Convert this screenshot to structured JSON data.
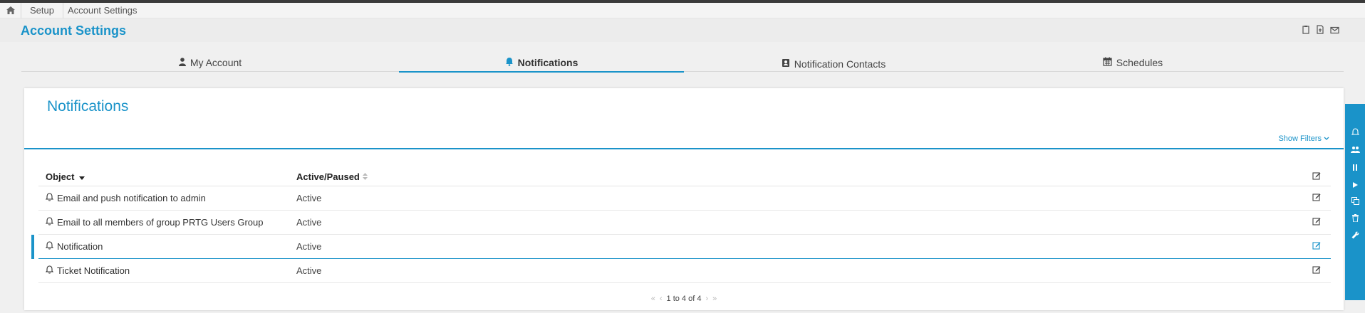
{
  "breadcrumb": {
    "items": [
      "Setup",
      "Account Settings"
    ]
  },
  "header": {
    "title": "Account Settings"
  },
  "tabs": [
    {
      "label": "My Account",
      "icon": "user-icon"
    },
    {
      "label": "Notifications",
      "icon": "bell-icon"
    },
    {
      "label": "Notification Contacts",
      "icon": "contact-icon"
    },
    {
      "label": "Schedules",
      "icon": "calendar-icon"
    }
  ],
  "panel": {
    "title": "Notifications",
    "show_filters": "Show Filters",
    "columns": {
      "object": "Object",
      "status": "Active/Paused"
    },
    "rows": [
      {
        "name": "Email and push notification to admin",
        "status": "Active"
      },
      {
        "name": "Email to all members of group PRTG Users Group",
        "status": "Active"
      },
      {
        "name": "Notification",
        "status": "Active"
      },
      {
        "name": "Ticket Notification",
        "status": "Active"
      }
    ],
    "pager": {
      "text": "1 to 4 of 4"
    }
  },
  "colors": {
    "accent": "#1a93c9"
  }
}
